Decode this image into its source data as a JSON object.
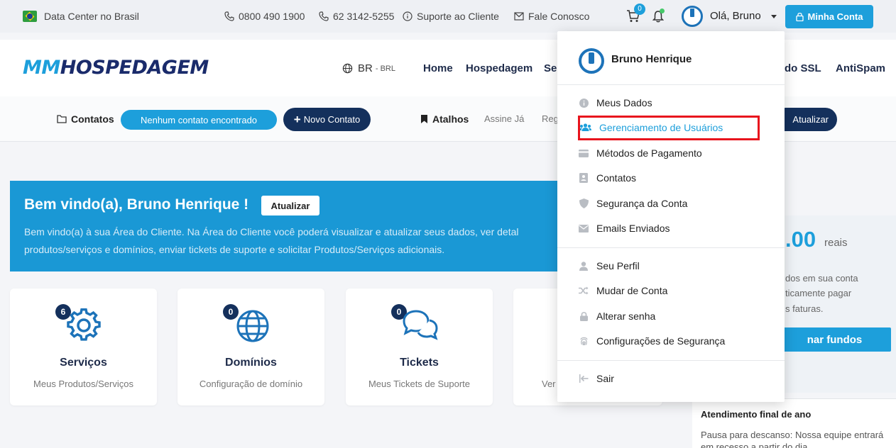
{
  "topbar": {
    "datacenter": "Data Center no Brasil",
    "phone1": "0800 490 1900",
    "phone2": "62 3142-5255",
    "support": "Suporte ao Cliente",
    "contact": "Fale Conosco",
    "cart_count": "0",
    "greeting": "Olá, Bruno",
    "account_button": "Minha Conta"
  },
  "header": {
    "logo_mm": "MM",
    "logo_rest": "HOSPEDAGEM",
    "lang_code": "BR",
    "lang_currency": "- BRL",
    "nav": [
      "Home",
      "Hospedagem",
      "Se",
      "do SSL",
      "AntiSpam"
    ]
  },
  "contactbar": {
    "contacts_label": "Contatos",
    "no_contacts": "Nenhum contato encontrado",
    "new_contact": "Novo Contato",
    "shortcuts_label": "Atalhos",
    "link1": "Assine Já",
    "link2": "Reg",
    "update": "Atualizar"
  },
  "welcome": {
    "title": "Bem vindo(a), Bruno Henrique !",
    "update_button": "Atualizar",
    "line1": "Bem vindo(a) à sua Área do Cliente. Na Área do Cliente você poderá visualizar e atualizar seus dados, ver detal",
    "line2": "produtos/serviços e domínios, enviar tickets de suporte e solicitar Produtos/Serviços adicionais."
  },
  "cards": [
    {
      "count": "6",
      "title": "Serviços",
      "subtitle": "Meus Produtos/Serviços",
      "icon": "gear-icon"
    },
    {
      "count": "0",
      "title": "Domínios",
      "subtitle": "Configuração de domínio",
      "icon": "globe-icon"
    },
    {
      "count": "0",
      "title": "Tickets",
      "subtitle": "Meus Tickets de Suporte",
      "icon": "chat-icon"
    },
    {
      "count": "",
      "title": "",
      "subtitle": "Ver",
      "icon": ""
    }
  ],
  "credit": {
    "amount": ".00",
    "unit": "reais",
    "text1": "dos em sua conta",
    "text2": "ticamente pagar",
    "text3": "s faturas.",
    "button": "nar fundos"
  },
  "notice": {
    "title": "Atendimento final de ano",
    "body": "Pausa para descanso: Nossa equipe entrará em recesso a partir do dia"
  },
  "dropdown": {
    "user_name": "Bruno Henrique",
    "items": [
      {
        "label": "Meus Dados",
        "icon": "info-icon"
      },
      {
        "label": "Gerenciamento de Usuários",
        "icon": "users-icon"
      },
      {
        "label": "Métodos de Pagamento",
        "icon": "credit-card-icon"
      },
      {
        "label": "Contatos",
        "icon": "address-book-icon"
      },
      {
        "label": "Segurança da Conta",
        "icon": "shield-icon"
      },
      {
        "label": "Emails Enviados",
        "icon": "envelope-icon"
      },
      {
        "label": "Seu Perfil",
        "icon": "user-icon"
      },
      {
        "label": "Mudar de Conta",
        "icon": "shuffle-icon"
      },
      {
        "label": "Alterar senha",
        "icon": "lock-icon"
      },
      {
        "label": "Configurações de Segurança",
        "icon": "fingerprint-icon"
      },
      {
        "label": "Sair",
        "icon": "sign-out-icon"
      }
    ]
  },
  "colors": {
    "accent": "#1d9fdb",
    "navy": "#14305c",
    "highlight": "#e8141d"
  }
}
